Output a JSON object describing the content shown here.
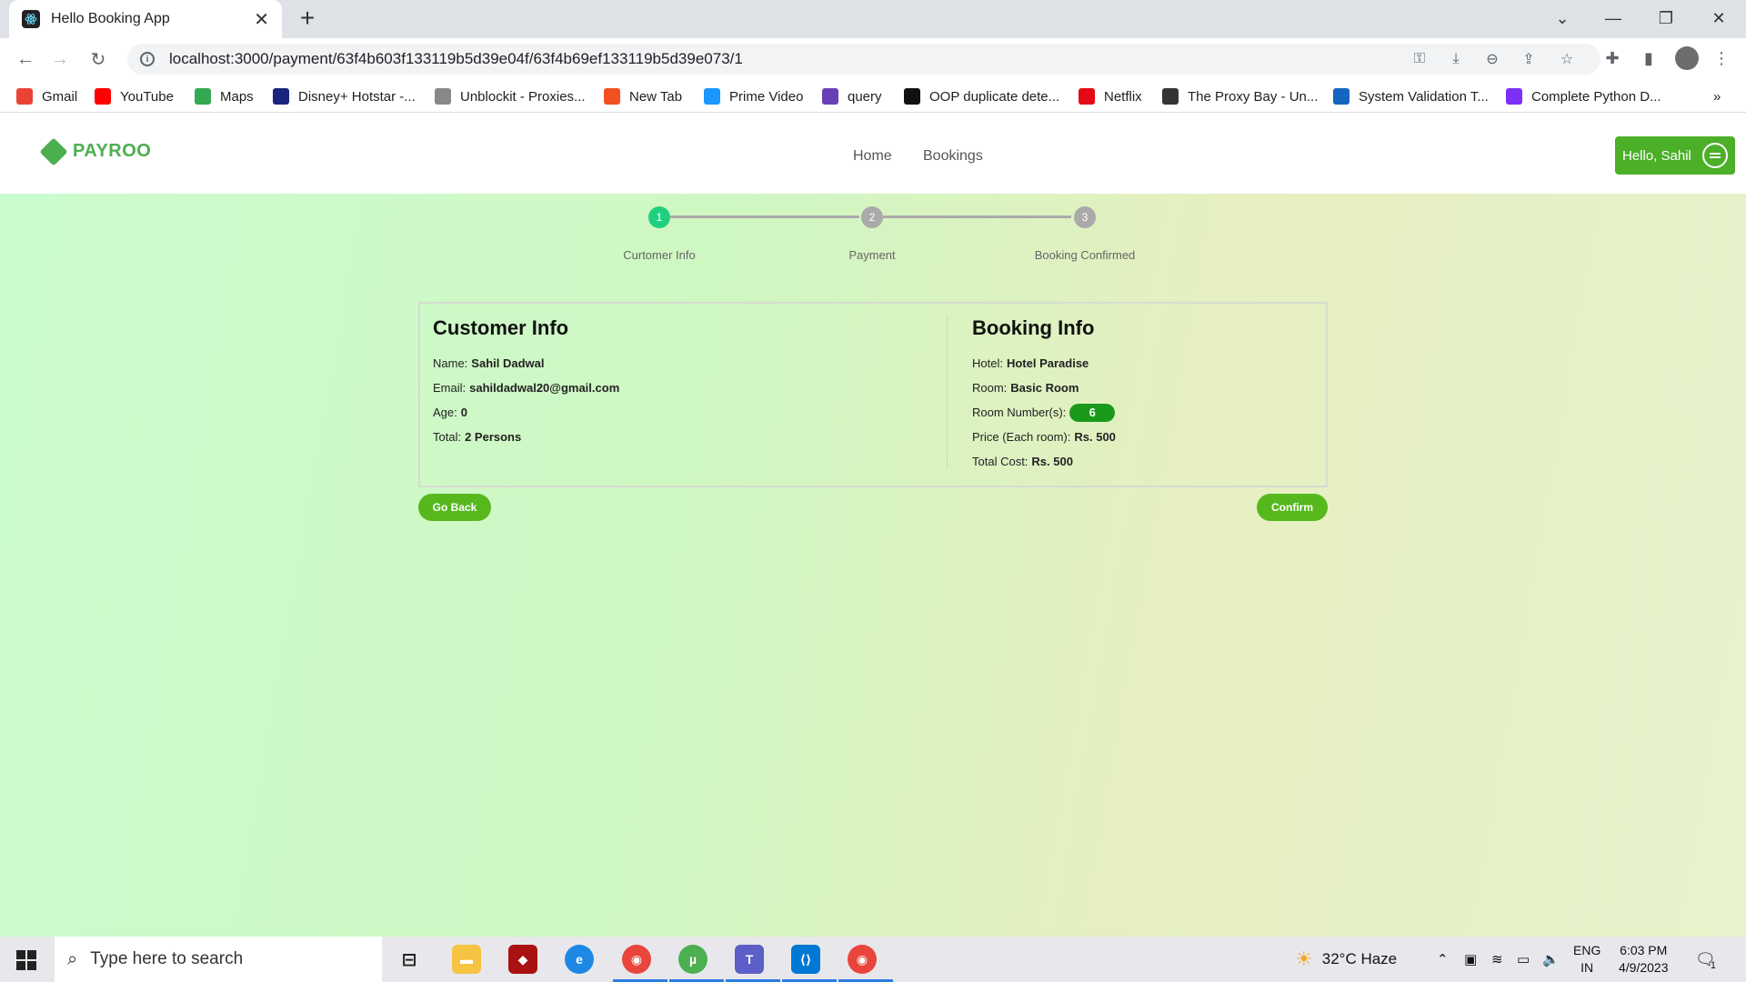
{
  "browser": {
    "tab_title": "Hello Booking App",
    "url": "localhost:3000/payment/63f4b603f133119b5d39e04f/63f4b69ef133119b5d39e073/1",
    "bookmarks": [
      {
        "label": "Gmail",
        "color": "#ea4335",
        "icon": "gmail-icon"
      },
      {
        "label": "YouTube",
        "color": "#ff0000",
        "icon": "youtube-icon"
      },
      {
        "label": "Maps",
        "color": "#34a853",
        "icon": "maps-icon"
      },
      {
        "label": "Disney+ Hotstar -...",
        "color": "#1a237e",
        "icon": "hotstar-icon"
      },
      {
        "label": "Unblockit - Proxies...",
        "color": "#888888",
        "icon": "unblockit-icon"
      },
      {
        "label": "New Tab",
        "color": "#f25022",
        "icon": "windows-icon"
      },
      {
        "label": "Prime Video",
        "color": "#1a98ff",
        "icon": "prime-icon"
      },
      {
        "label": "query",
        "color": "#6a3fb5",
        "icon": "query-icon"
      },
      {
        "label": "OOP duplicate dete...",
        "color": "#111111",
        "icon": "github-icon"
      },
      {
        "label": "Netflix",
        "color": "#e50914",
        "icon": "netflix-icon"
      },
      {
        "label": "The Proxy Bay - Un...",
        "color": "#333333",
        "icon": "ship-icon"
      },
      {
        "label": "System Validation T...",
        "color": "#1565c0",
        "icon": "validation-icon"
      },
      {
        "label": "Complete Python D...",
        "color": "#7b2ff7",
        "icon": "udemy-icon"
      }
    ],
    "overflow": "»"
  },
  "app": {
    "logo": "PAYROO",
    "nav": {
      "home": "Home",
      "bookings": "Bookings"
    },
    "user_button": "Hello, Sahil"
  },
  "steps": [
    {
      "num": "1",
      "label": "Curtomer Info",
      "active": true
    },
    {
      "num": "2",
      "label": "Payment",
      "active": false
    },
    {
      "num": "3",
      "label": "Booking Confirmed",
      "active": false
    }
  ],
  "customer": {
    "heading": "Customer Info",
    "name_label": "Name:",
    "name": "Sahil Dadwal",
    "email_label": "Email:",
    "email": "sahildadwal20@gmail.com",
    "age_label": "Age:",
    "age": "0",
    "total_label": "Total:",
    "total": "2 Persons"
  },
  "booking": {
    "heading": "Booking Info",
    "hotel_label": "Hotel:",
    "hotel": "Hotel Paradise",
    "room_label": "Room:",
    "room": "Basic Room",
    "room_numbers_label": "Room Number(s):",
    "room_numbers": "6",
    "price_label": "Price (Each room):",
    "price": "Rs. 500",
    "cost_label": "Total Cost:",
    "cost": "Rs. 500"
  },
  "buttons": {
    "back": "Go Back",
    "confirm": "Confirm"
  },
  "taskbar": {
    "search_placeholder": "Type here to search",
    "weather": "32°C  Haze",
    "lang_top": "ENG",
    "lang_bottom": "IN",
    "time": "6:03 PM",
    "date": "4/9/2023",
    "notif_count": "1"
  },
  "colors": {
    "accent": "#4caf28",
    "step_active": "#20d080",
    "step_inactive": "#aaaaaa",
    "pill": "#1a9a1a"
  }
}
